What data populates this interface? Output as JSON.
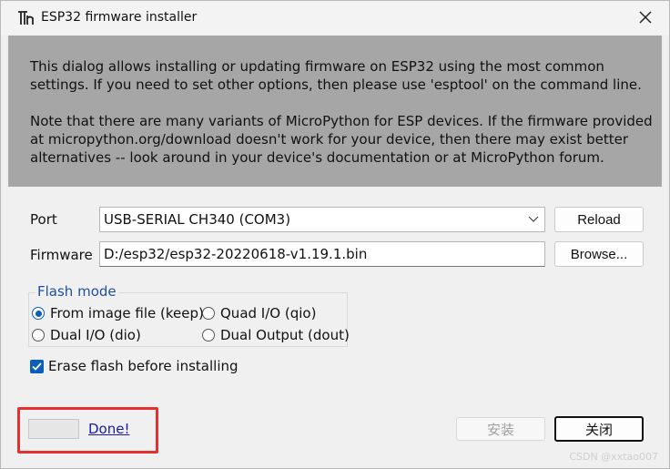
{
  "window": {
    "title": "ESP32 firmware installer",
    "close_icon": "close-icon",
    "app_icon": "thonny-icon"
  },
  "info": {
    "paragraph1": "This dialog allows installing or updating firmware on ESP32 using the most common settings. If you need to set other options, then please use 'esptool' on the command line.",
    "paragraph2": "Note that there are many variants of MicroPython for ESP devices. If the firmware provided at micropython.org/download doesn't work for your device, then there may exist better alternatives -- look around in your device's documentation or at MicroPython forum."
  },
  "port": {
    "label": "Port",
    "value": "USB-SERIAL CH340 (COM3)",
    "reload_label": "Reload"
  },
  "firmware": {
    "label": "Firmware",
    "value": "D:/esp32/esp32-20220618-v1.19.1.bin",
    "browse_label": "Browse..."
  },
  "flash_mode": {
    "title": "Flash mode",
    "options": [
      {
        "label": "From image file (keep)",
        "checked": true
      },
      {
        "label": "Quad I/O (qio)",
        "checked": false
      },
      {
        "label": "Dual I/O (dio)",
        "checked": false
      },
      {
        "label": "Dual Output (dout)",
        "checked": false
      }
    ]
  },
  "erase": {
    "label": "Erase flash before installing",
    "checked": true
  },
  "footer": {
    "status_link": "Done!",
    "install_label": "安装",
    "close_label": "关闭",
    "watermark": "CSDN @xxtao007"
  },
  "colors": {
    "info_bg": "#a6a6a6",
    "accent": "#0c5fb8",
    "highlight": "#e53030",
    "link": "#1a1aa8"
  }
}
